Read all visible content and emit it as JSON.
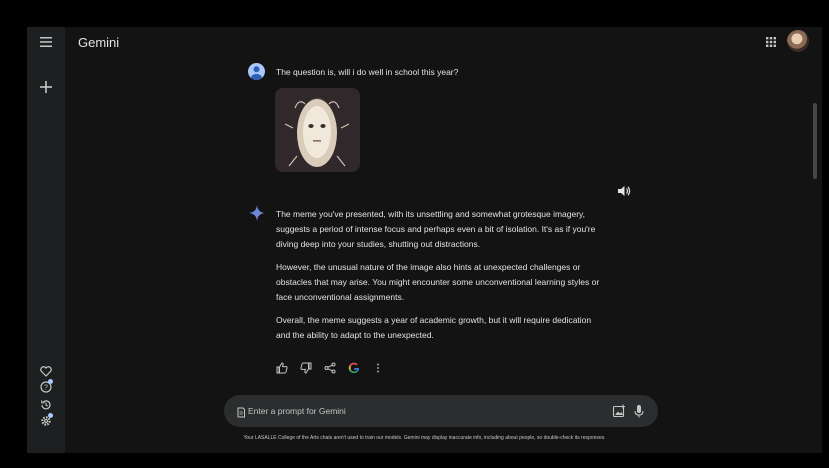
{
  "app": {
    "title": "Gemini"
  },
  "sidebar": {
    "menu_icon": "hamburger-menu-icon",
    "new_chat_icon": "plus-icon",
    "bottom_icons": [
      "gem-heart-icon",
      "help-icon",
      "activity-icon",
      "settings-icon"
    ]
  },
  "conversation": {
    "user_message": "The question is, will i do well in school this year?",
    "response_paragraphs": [
      "The meme you've presented, with its unsettling and somewhat grotesque imagery, suggests a period of intense focus and perhaps even a bit of isolation. It's as if you're diving deep into your studies, shutting out distractions.",
      "However, the unusual nature of the image also hints at unexpected challenges or obstacles that may arise. You might encounter some unconventional learning styles or face unconventional assignments.",
      "Overall, the meme suggests a year of academic growth, but it will require dedication and the ability to adapt to the unexpected."
    ],
    "action_icons": [
      "thumbs-up-icon",
      "thumbs-down-icon",
      "share-icon",
      "google-g-icon",
      "more-vert-icon"
    ]
  },
  "prompt": {
    "placeholder": "Enter a prompt for Gemini"
  },
  "footer": {
    "disclaimer": "Your LASALLE College of the Arts chats aren't used to train our models. Gemini may display inaccurate info, including about people, so double-check its responses."
  },
  "colors": {
    "background": "#131314",
    "sidebar": "#1e1f20",
    "accent": "#a8c7fa",
    "text": "#e3e3e3"
  }
}
